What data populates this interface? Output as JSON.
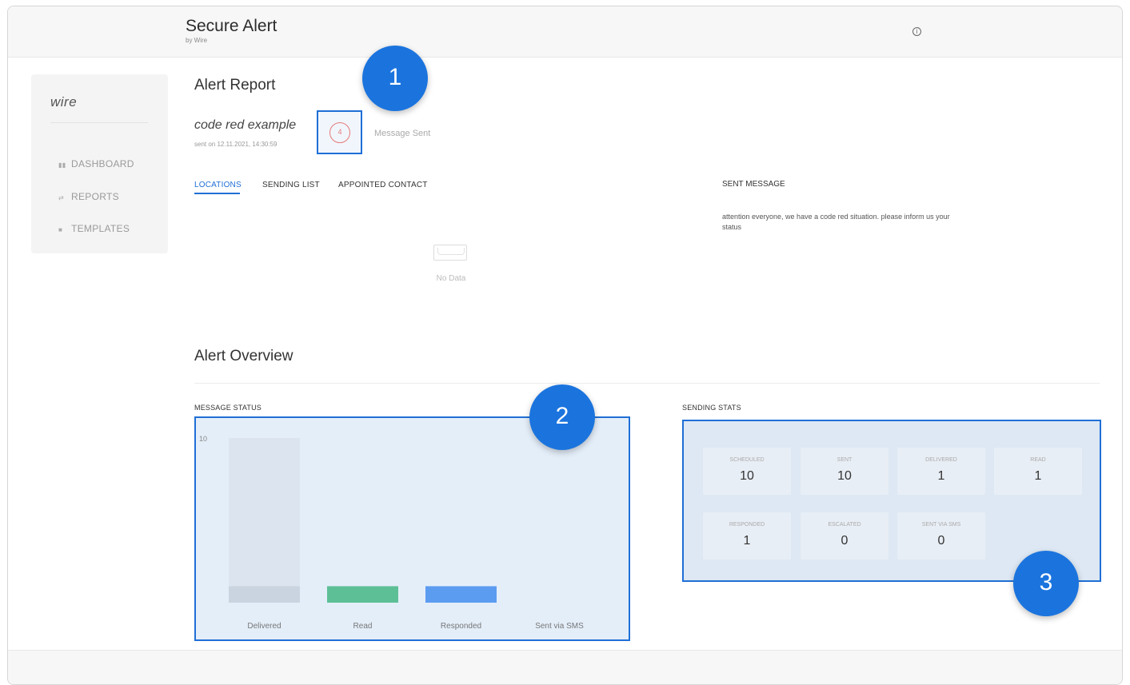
{
  "header": {
    "title": "Secure Alert",
    "subtitle": "by Wire"
  },
  "sidebar": {
    "logo": "wire",
    "items": [
      {
        "label": "DASHBOARD",
        "icon": "dashboard-icon"
      },
      {
        "label": "REPORTS",
        "icon": "reports-icon"
      },
      {
        "label": "TEMPLATES",
        "icon": "templates-icon"
      }
    ]
  },
  "report": {
    "title": "Alert Report",
    "alert_name": "code red example",
    "sent_on": "sent on 12.11.2021, 14:30:59",
    "messages_sent_count": "4",
    "messages_sent_label": "Message Sent",
    "tabs": [
      "LOCATIONS",
      "SENDING LIST",
      "APPOINTED CONTACT"
    ],
    "active_tab": "LOCATIONS",
    "empty_text": "No Data",
    "sent_message_label": "SENT MESSAGE",
    "sent_message_text": "attention everyone, we have a code red situation. please inform us your status"
  },
  "overview": {
    "title": "Alert Overview",
    "message_status_label": "MESSAGE STATUS",
    "sending_stats_label": "SENDING STATS",
    "stats": [
      {
        "label": "SCHEDULED",
        "value": "10"
      },
      {
        "label": "SENT",
        "value": "10"
      },
      {
        "label": "DELIVERED",
        "value": "1"
      },
      {
        "label": "READ",
        "value": "1"
      },
      {
        "label": "RESPONDED",
        "value": "1"
      },
      {
        "label": "ESCALATED",
        "value": "0"
      },
      {
        "label": "SENT VIA SMS",
        "value": "0"
      }
    ]
  },
  "badges": [
    "1",
    "2",
    "3"
  ],
  "chart_data": {
    "type": "bar",
    "categories": [
      "Delivered",
      "Read",
      "Responded",
      "Sent via SMS"
    ],
    "total": 10,
    "values": [
      1,
      1,
      1,
      0
    ],
    "colors": [
      "#c9d4e0",
      "#5dbf96",
      "#5c9cf0",
      "#cccccc"
    ],
    "background_color": "#dce5ef",
    "ymax_label": "10",
    "ylim": [
      0,
      10
    ]
  },
  "colors": {
    "accent": "#1f6fd6",
    "badge": "#1b74de",
    "count_ring": "#e67b7b"
  }
}
